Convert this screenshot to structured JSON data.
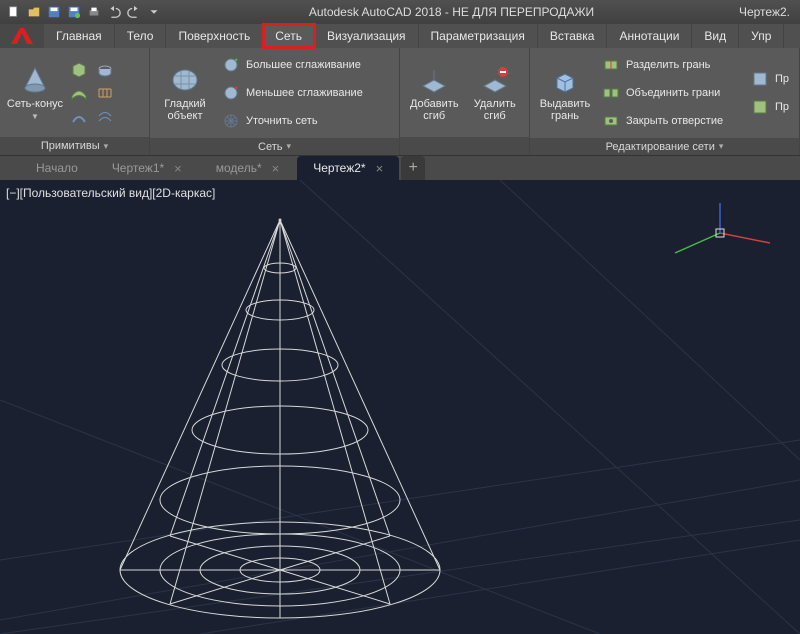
{
  "app": {
    "title": "Autodesk AutoCAD 2018 - НЕ ДЛЯ ПЕРЕПРОДАЖИ",
    "docname": "Чертеж2."
  },
  "menu": {
    "tabs": [
      "Главная",
      "Тело",
      "Поверхность",
      "Сеть",
      "Визуализация",
      "Параметризация",
      "Вставка",
      "Аннотации",
      "Вид",
      "Упр"
    ],
    "active_index": 3
  },
  "ribbon": {
    "panel_primitives": {
      "title": "Примитивы",
      "mesh_cone": "Сеть-конус"
    },
    "panel_mesh": {
      "title": "Сеть",
      "smooth_object": "Гладкий\nобъект",
      "more_smooth": "Большее сглаживание",
      "less_smooth": "Меньшее сглаживание",
      "refine": "Уточнить сеть"
    },
    "panel_fold": {
      "add_fold": "Добавить\nсгиб",
      "del_fold": "Удалить\nсгиб"
    },
    "panel_edit": {
      "title": "Редактирование сети",
      "extrude": "Выдавить\nгрань",
      "split_face": "Разделить грань",
      "merge_face": "Объединить грани",
      "close_hole": "Закрыть отверстие",
      "pr": "Пр"
    }
  },
  "doc_tabs": {
    "items": [
      "Начало",
      "Чертеж1*",
      "модель*",
      "Чертеж2*"
    ],
    "active_index": 3
  },
  "viewport": {
    "label": "[−][Пользовательский вид][2D-каркас]"
  },
  "colors": {
    "highlight": "#d92020",
    "axis_x": "#d04040",
    "axis_y": "#40c040",
    "axis_z": "#4060d0"
  }
}
